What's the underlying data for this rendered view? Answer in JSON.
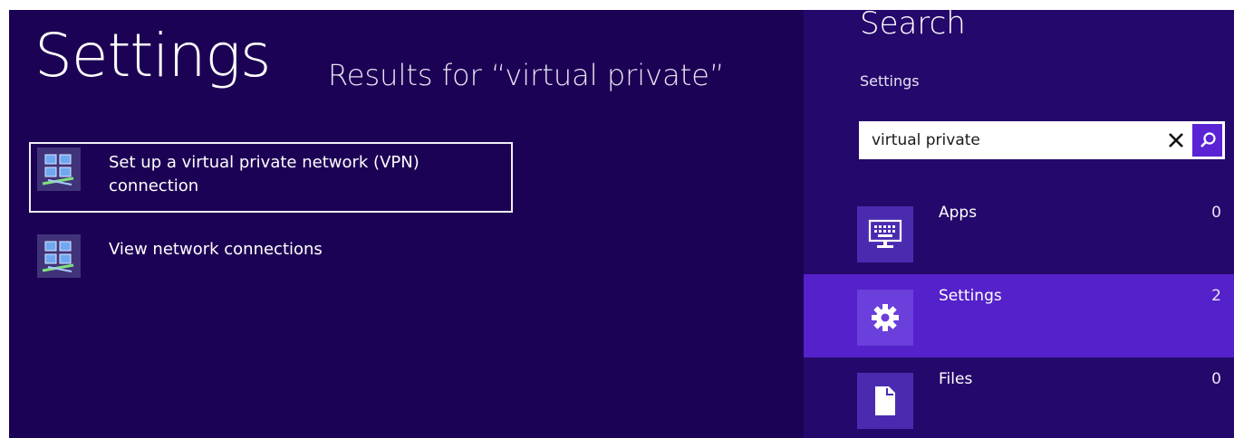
{
  "results_pane": {
    "title": "Settings",
    "results_for": "Results for “virtual private”",
    "items": [
      {
        "label": "Set up a virtual private network (VPN) connection",
        "icon": "network-connections-icon",
        "selected": true
      },
      {
        "label": "View network connections",
        "icon": "network-connections-icon",
        "selected": false
      }
    ]
  },
  "search_charm": {
    "title": "Search",
    "scope": "Settings",
    "query": "virtual private",
    "clear_icon": "close-icon",
    "search_icon": "search-icon",
    "categories": [
      {
        "name": "Apps",
        "count": "0",
        "icon": "apps-keyboard-icon",
        "active": false
      },
      {
        "name": "Settings",
        "count": "2",
        "icon": "gear-icon",
        "active": true
      },
      {
        "name": "Files",
        "count": "0",
        "icon": "file-icon",
        "active": false
      }
    ]
  },
  "colors": {
    "results_background": "#1c0255",
    "charm_background": "#25086b",
    "active_category": "#5521ca",
    "search_button": "#5a24d4"
  }
}
